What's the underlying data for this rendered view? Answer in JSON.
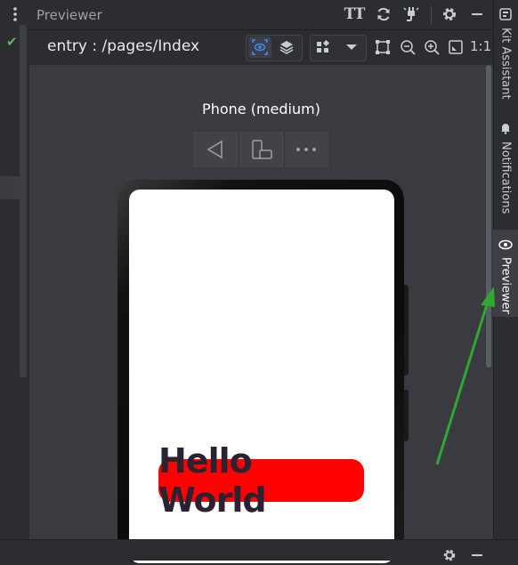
{
  "tool_window": {
    "title": "Previewer",
    "font_size_label": "TT"
  },
  "toolbar": {
    "route": "entry : /pages/Index",
    "one_to_one_label": "1:1"
  },
  "device": {
    "name": "Phone (medium)"
  },
  "preview_content": {
    "text": "Hello World",
    "background_color": "#ff0000",
    "text_color": "#2a2230"
  },
  "right_sidebar": {
    "tabs": [
      {
        "label": "Kit Assistant",
        "icon": "kit-icon"
      },
      {
        "label": "Notifications",
        "icon": "bell-icon"
      },
      {
        "label": "Previewer",
        "icon": "eye-icon",
        "active": true
      }
    ]
  },
  "annotation": {
    "arrow_color": "#2fa82f"
  }
}
